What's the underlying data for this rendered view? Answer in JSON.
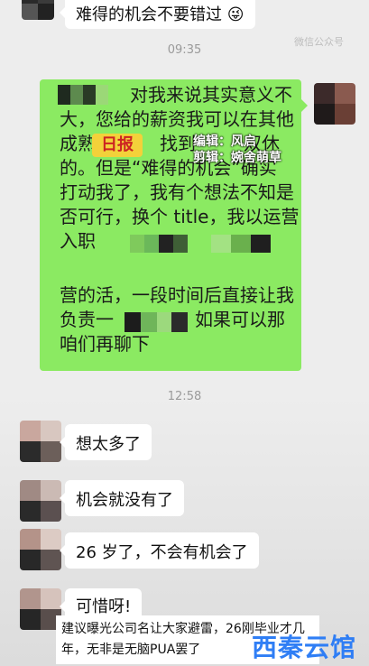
{
  "messages_top": {
    "bubble_text": "难得的机会不要错过",
    "emoji": "😜"
  },
  "timestamps": {
    "first": "09:35",
    "second": "12:58"
  },
  "source_watermark": "微信公众号",
  "green_message": {
    "lines": [
      "对我来说其实意义不",
      "大，您给的薪资我可以在其他",
      "成熟",
      "找到",
      "双休",
      "的。但是“难得的机会”确实",
      "打动我了，我有个想法不知是",
      "否可行，换个 title，我以运营",
      "入职",
      "营的活，一段时间后直接让我",
      "负责一",
      "如果可以那",
      "咱们再聊下"
    ]
  },
  "editor_overlay": {
    "logo_text": "日报",
    "editor_line": "编辑：风启",
    "cut_line": "剪辑：婉舍萌草"
  },
  "replies": [
    {
      "text": "想太多了"
    },
    {
      "text": "机会就没有了"
    },
    {
      "text": "26 岁了，不会有机会了"
    },
    {
      "text": "可惜呀!"
    }
  ],
  "caption": {
    "text": "建议曝光公司名让大家避雷，26刚毕业才几年，无非是无脑PUA罢了"
  },
  "brand_watermark": "西秦云馆",
  "colors": {
    "green_bubble": "#8bea62",
    "background": "#ededed",
    "watermark_blue": "#2f7ef5"
  }
}
